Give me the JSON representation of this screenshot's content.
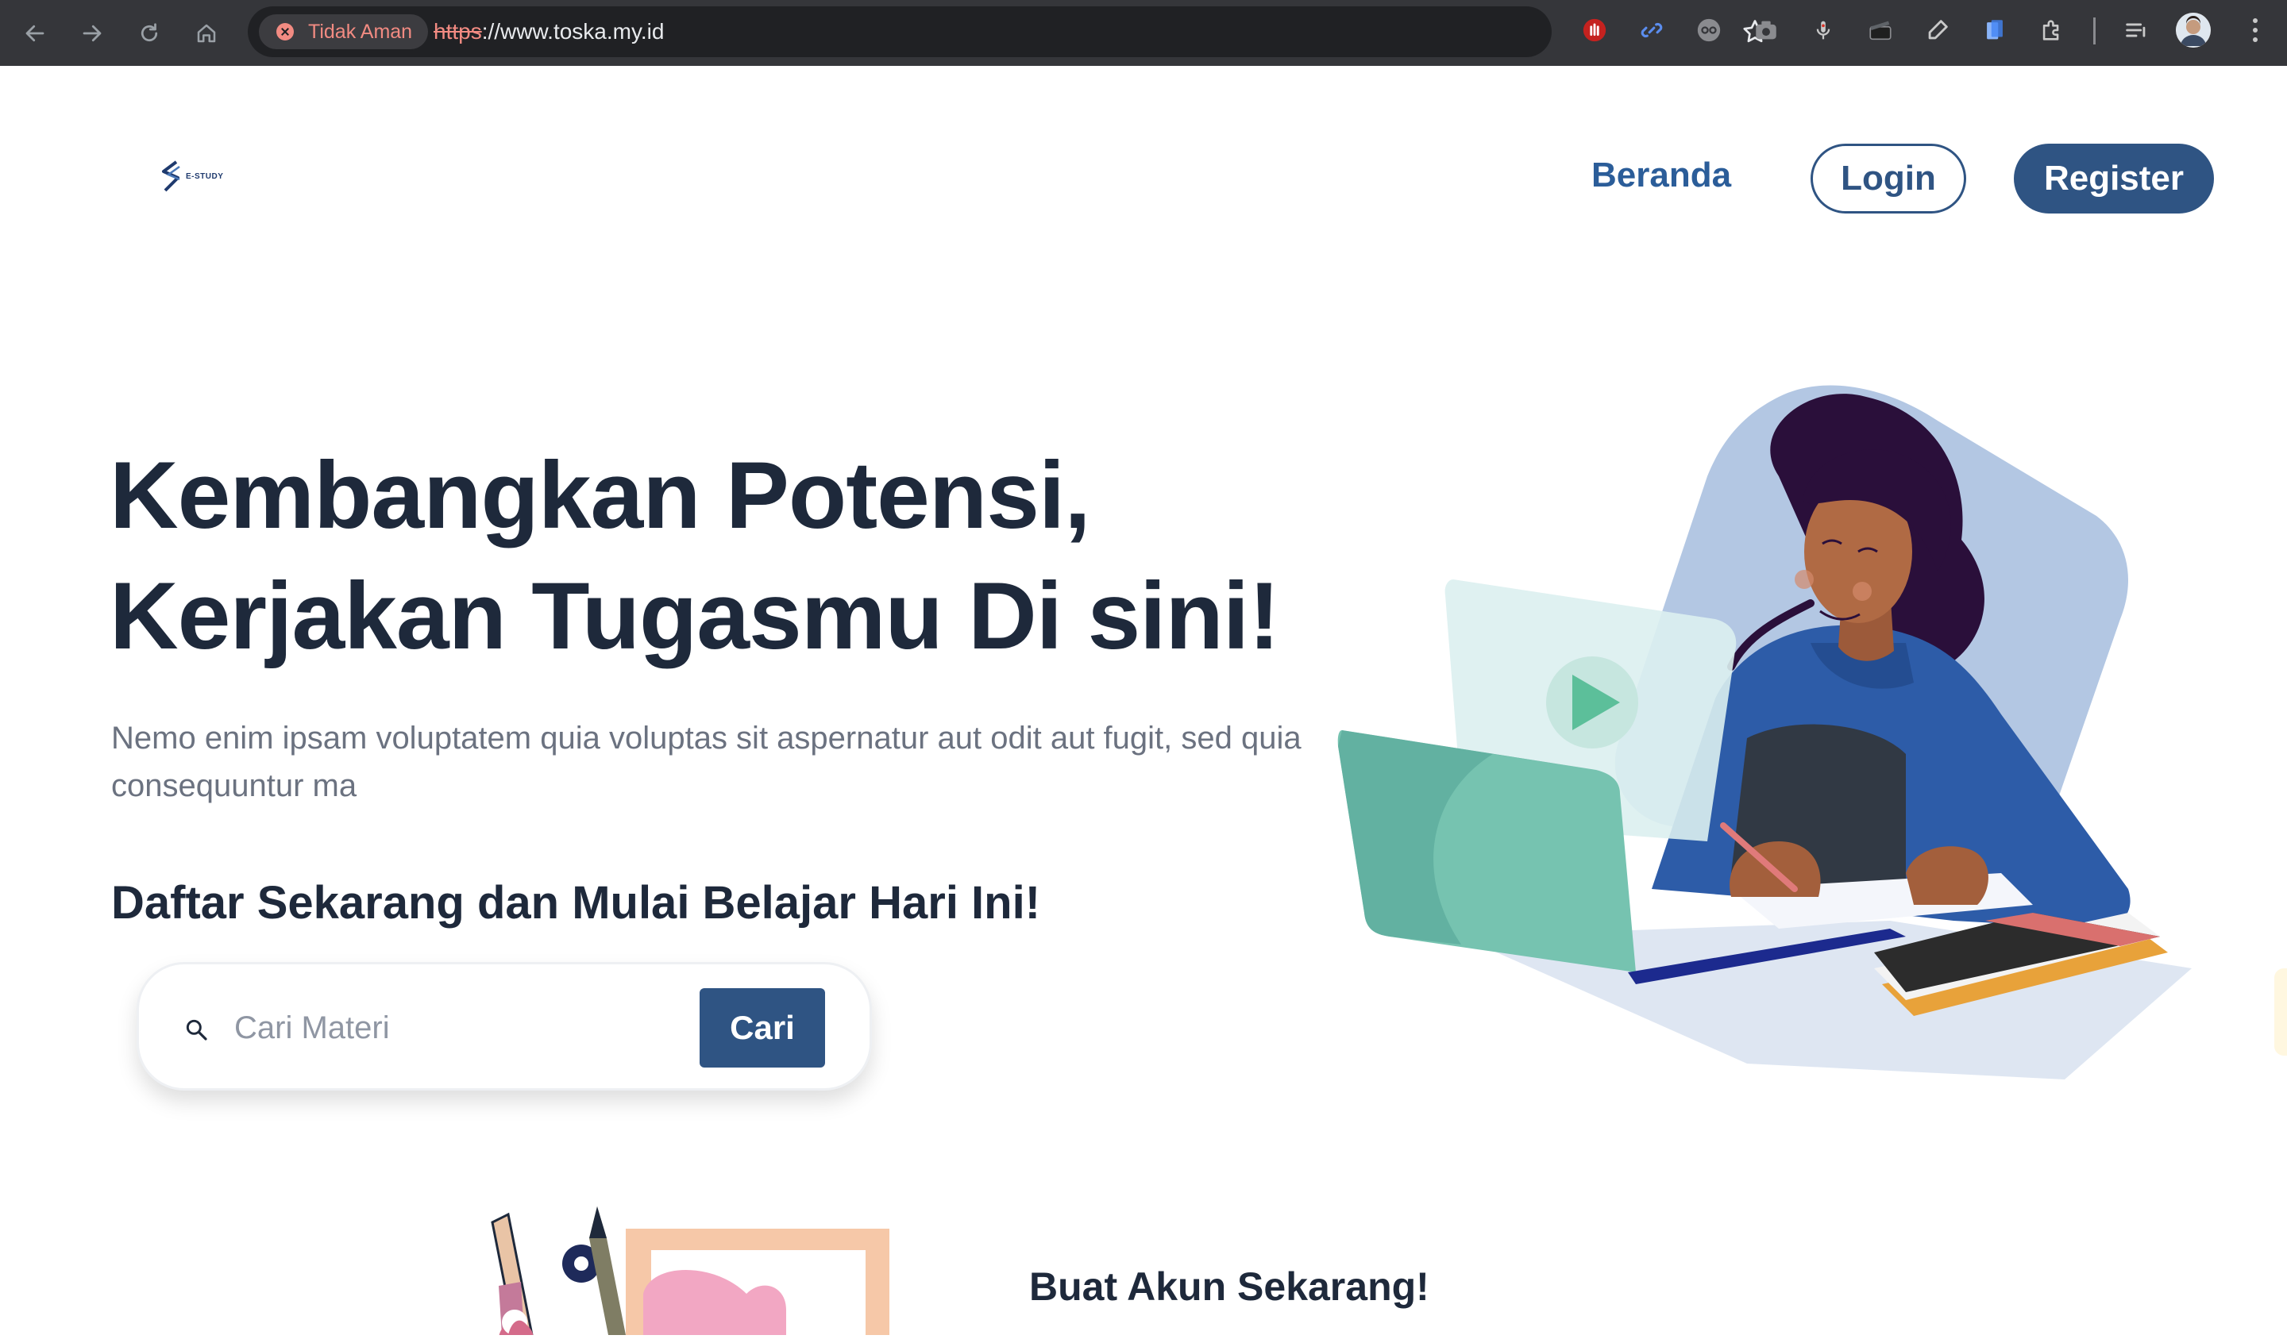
{
  "browser": {
    "security_label": "Tidak Aman",
    "url_scheme": "https",
    "url_rest": "://www.toska.my.id"
  },
  "site": {
    "logo_text": "E-STUDY",
    "nav": {
      "beranda": "Beranda",
      "login": "Login",
      "register": "Register"
    }
  },
  "hero": {
    "title_line1": "Kembangkan Potensi,",
    "title_line2": "Kerjakan Tugasmu Di sini!",
    "description": "Nemo enim ipsam voluptatem quia voluptas sit aspernatur aut odit aut fugit, sed quia consequuntur ma",
    "cta": "Daftar Sekarang dan Mulai Belajar Hari Ini!"
  },
  "search": {
    "placeholder": "Cari Materi",
    "value": "",
    "button_label": "Cari"
  },
  "section2": {
    "title": "Buat Akun Sekarang!"
  },
  "colors": {
    "primary": "#2f5483",
    "heading": "#1e293b",
    "muted": "#6b7280",
    "link": "#2b5d99"
  }
}
